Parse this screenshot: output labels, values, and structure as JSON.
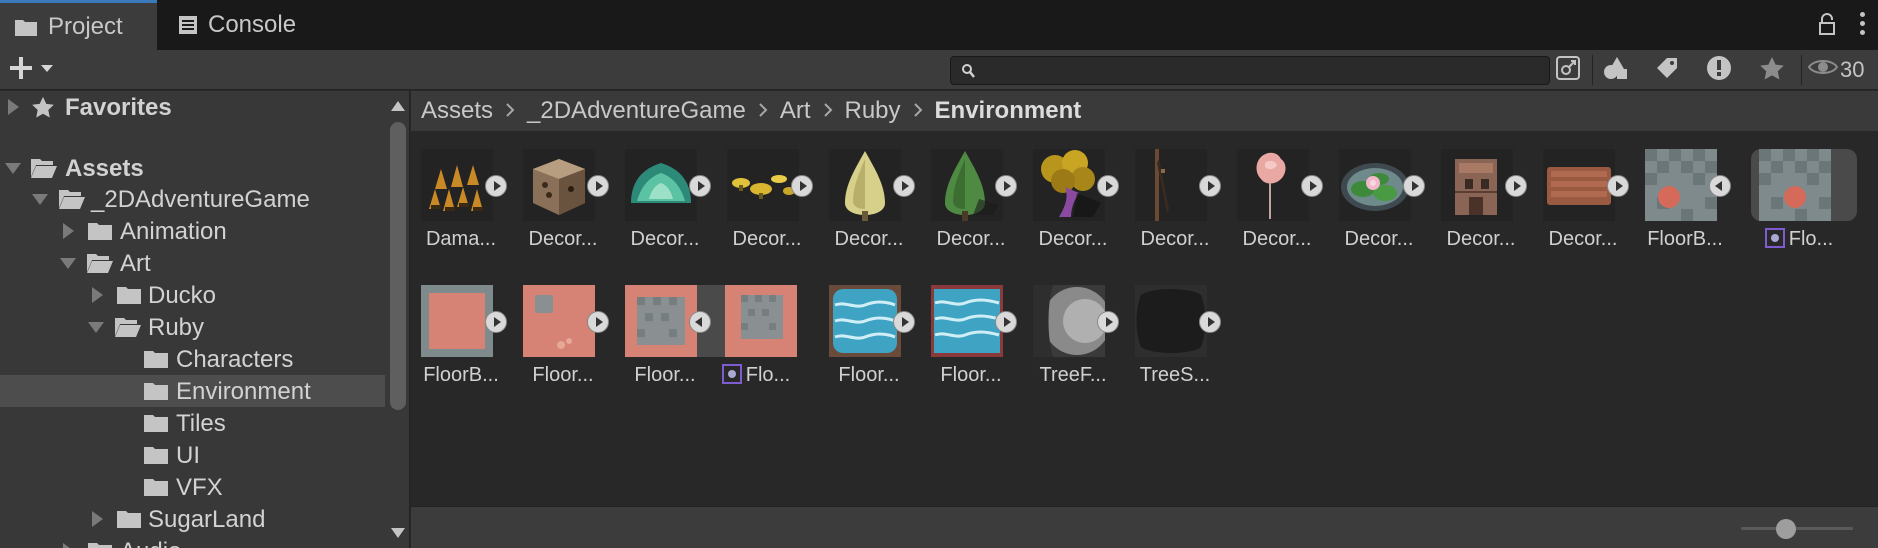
{
  "tabs": [
    {
      "label": "Project",
      "icon": "folder-icon",
      "active": true
    },
    {
      "label": "Console",
      "icon": "console-icon",
      "active": false
    }
  ],
  "toolbar": {
    "search_value": "",
    "visibility_count": "30"
  },
  "tree": [
    {
      "label": "Favorites",
      "bold": true,
      "icon": "star-icon",
      "expand": "right"
    },
    {
      "label": "Assets",
      "bold": true,
      "icon": "folder-open-icon",
      "expand": "down"
    },
    {
      "label": "_2DAdventureGame",
      "icon": "folder-open-icon",
      "expand": "down"
    },
    {
      "label": "Animation",
      "icon": "folder-icon",
      "expand": "right"
    },
    {
      "label": "Art",
      "icon": "folder-open-icon",
      "expand": "down"
    },
    {
      "label": "Ducko",
      "icon": "folder-icon",
      "expand": "right"
    },
    {
      "label": "Ruby",
      "icon": "folder-open-icon",
      "expand": "down"
    },
    {
      "label": "Characters",
      "icon": "folder-icon",
      "expand": "none"
    },
    {
      "label": "Environment",
      "icon": "folder-icon",
      "expand": "none",
      "selected": true
    },
    {
      "label": "Tiles",
      "icon": "folder-icon",
      "expand": "none"
    },
    {
      "label": "UI",
      "icon": "folder-icon",
      "expand": "none"
    },
    {
      "label": "VFX",
      "icon": "folder-icon",
      "expand": "none"
    },
    {
      "label": "SugarLand",
      "icon": "folder-icon",
      "expand": "right"
    },
    {
      "label": "Audio",
      "icon": "folder-icon",
      "expand": "right"
    }
  ],
  "breadcrumb": [
    "Assets",
    "_2DAdventureGame",
    "Art",
    "Ruby",
    "Environment"
  ],
  "assets": [
    {
      "label": "Dama...",
      "thumb": "damage-spikes-thumbnail"
    },
    {
      "label": "Decor...",
      "thumb": "crate-thumbnail"
    },
    {
      "label": "Decor...",
      "thumb": "bush-thumbnail"
    },
    {
      "label": "Decor...",
      "thumb": "mushrooms-thumbnail"
    },
    {
      "label": "Decor...",
      "thumb": "yellow-tree-thumbnail"
    },
    {
      "label": "Decor...",
      "thumb": "green-tree-thumbnail"
    },
    {
      "label": "Decor...",
      "thumb": "purple-tree-thumbnail"
    },
    {
      "label": "Decor...",
      "thumb": "wooden-post-thumbnail"
    },
    {
      "label": "Decor...",
      "thumb": "pink-tree-thumbnail"
    },
    {
      "label": "Decor...",
      "thumb": "lily-pond-thumbnail"
    },
    {
      "label": "Decor...",
      "thumb": "house-thumbnail"
    },
    {
      "label": "Decor...",
      "thumb": "wooden-crate-thumbnail"
    },
    {
      "label": "FloorB...",
      "thumb": "floor-tile-gray-thumbnail"
    },
    {
      "label": "Flo...",
      "thumb": "floor-tile-gray-thumbnail",
      "subasset": true
    },
    {
      "label": "FloorB...",
      "thumb": "floor-tile-border-thumbnail"
    },
    {
      "label": "Floor...",
      "thumb": "floor-tile-pink-thumbnail"
    },
    {
      "label": "Floor...",
      "thumb": "floor-tile-pink-center-thumbnail"
    },
    {
      "label": "Flo...",
      "thumb": "floor-tile-pink-center-thumbnail",
      "subasset": true
    },
    {
      "label": "Floor...",
      "thumb": "water-tile-thumbnail"
    },
    {
      "label": "Floor...",
      "thumb": "water-tile-2-thumbnail"
    },
    {
      "label": "TreeF...",
      "thumb": "tree-shadow-thumbnail"
    },
    {
      "label": "TreeS...",
      "thumb": "tree-shadow-dark-thumbnail"
    }
  ]
}
